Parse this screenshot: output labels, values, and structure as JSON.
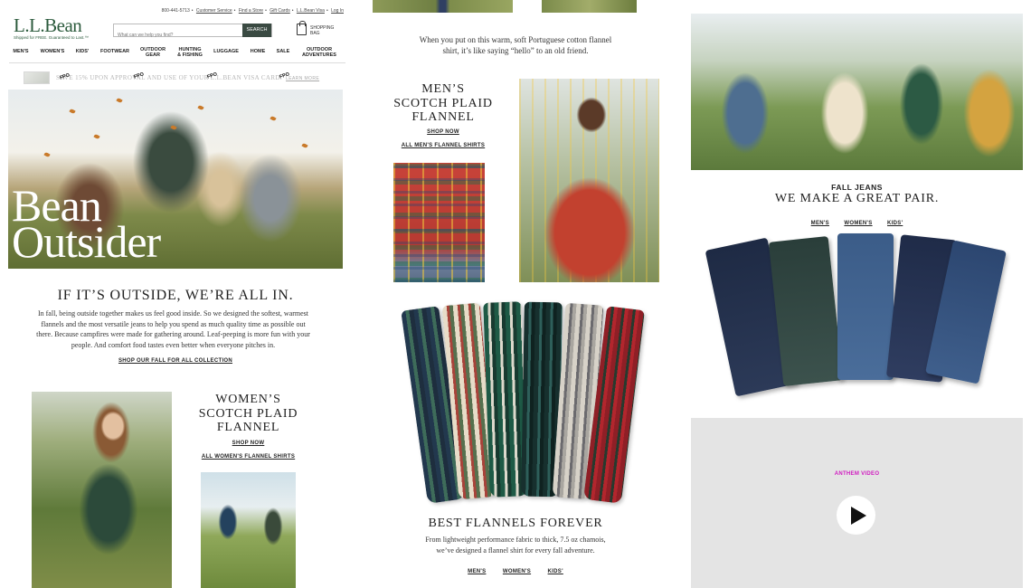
{
  "utility_bar": {
    "phone": "800-441-5713",
    "links": [
      "Customer Service",
      "Find a Store",
      "Gift Cards",
      "L.L.Bean Visa",
      "Log In"
    ]
  },
  "logo": {
    "name": "L.L.Bean",
    "tagline": "Shipped for FREE. Guaranteed to Last.™"
  },
  "search": {
    "placeholder": "What can we help you find?",
    "button": "SEARCH"
  },
  "cart": {
    "label_line1": "SHOPPING",
    "label_line2": "BAG"
  },
  "nav": {
    "items": [
      "MEN'S",
      "WOMEN'S",
      "KIDS'",
      "FOOTWEAR",
      "OUTDOOR GEAR",
      "HUNTING & FISHING",
      "LUGGAGE",
      "HOME",
      "SALE",
      "OUTDOOR ADVENTURES"
    ],
    "lines": [
      [
        "MEN'S"
      ],
      [
        "WOMEN'S"
      ],
      [
        "KIDS'"
      ],
      [
        "FOOTWEAR"
      ],
      [
        "OUTDOOR",
        "GEAR"
      ],
      [
        "HUNTING",
        "& FISHING"
      ],
      [
        "LUGGAGE"
      ],
      [
        "HOME"
      ],
      [
        "SALE"
      ],
      [
        "OUTDOOR",
        "ADVENTURES"
      ]
    ]
  },
  "promo": {
    "text": "SAVE 15% UPON APPROVAL AND USE OF YOUR L.L.BEAN VISA CARD.",
    "learn_more": "LEARN MORE",
    "fpo_marks": [
      "FPO",
      "FPO",
      "FPO",
      "FPO"
    ]
  },
  "hero": {
    "title_line1": "Bean",
    "title_line2": "Outsider"
  },
  "intro": {
    "heading": "IF IT’S OUTSIDE, WE’RE ALL IN.",
    "body": "In fall, being outside together makes us feel good inside. So we designed the softest, warmest flannels and the most versatile jeans to help you spend as much quality time as possible out there. Because campfires were made for gathering around. Leaf-peeping is more fun with your people. And comfort food tastes even better when everyone pitches in.",
    "cta": "SHOP OUR FALL FOR ALL COLLECTION"
  },
  "womens_flannel": {
    "heading_line1": "WOMEN’S",
    "heading_line2": "SCOTCH PLAID",
    "heading_line3": "FLANNEL",
    "shop_now": "SHOP NOW",
    "all_link": "ALL WOMEN'S FLANNEL SHIRTS"
  },
  "mens_flannel": {
    "intro_line1": "When you put on this warm, soft Portuguese cotton flannel",
    "intro_line2": "shirt, it’s like saying “hello” to an old friend.",
    "heading_line1": "MEN’S",
    "heading_line2": "SCOTCH PLAID",
    "heading_line3": "FLANNEL",
    "shop_now": "SHOP NOW",
    "all_link": "ALL MEN'S FLANNEL SHIRTS"
  },
  "best_flannels": {
    "heading": "BEST FLANNELS FOREVER",
    "body_line1": "From lightweight performance fabric to thick, 7.5 oz chamois,",
    "body_line2": "we’ve designed a flannel shirt for every fall adventure.",
    "links": [
      "MEN'S",
      "WOMEN'S",
      "KIDS'"
    ]
  },
  "fall_jeans": {
    "eyebrow": "FALL JEANS",
    "heading": "WE MAKE A GREAT PAIR.",
    "links": [
      "MEN'S",
      "WOMEN'S",
      "KIDS'"
    ]
  },
  "video": {
    "label": "ANTHEM VIDEO"
  },
  "colors": {
    "brand_green": "#2b5a3c",
    "search_button": "#3a4a42",
    "video_label": "#d01ac0",
    "video_bg": "#e4e4e4"
  },
  "icons": [
    "shopping-bag-icon",
    "play-icon"
  ]
}
